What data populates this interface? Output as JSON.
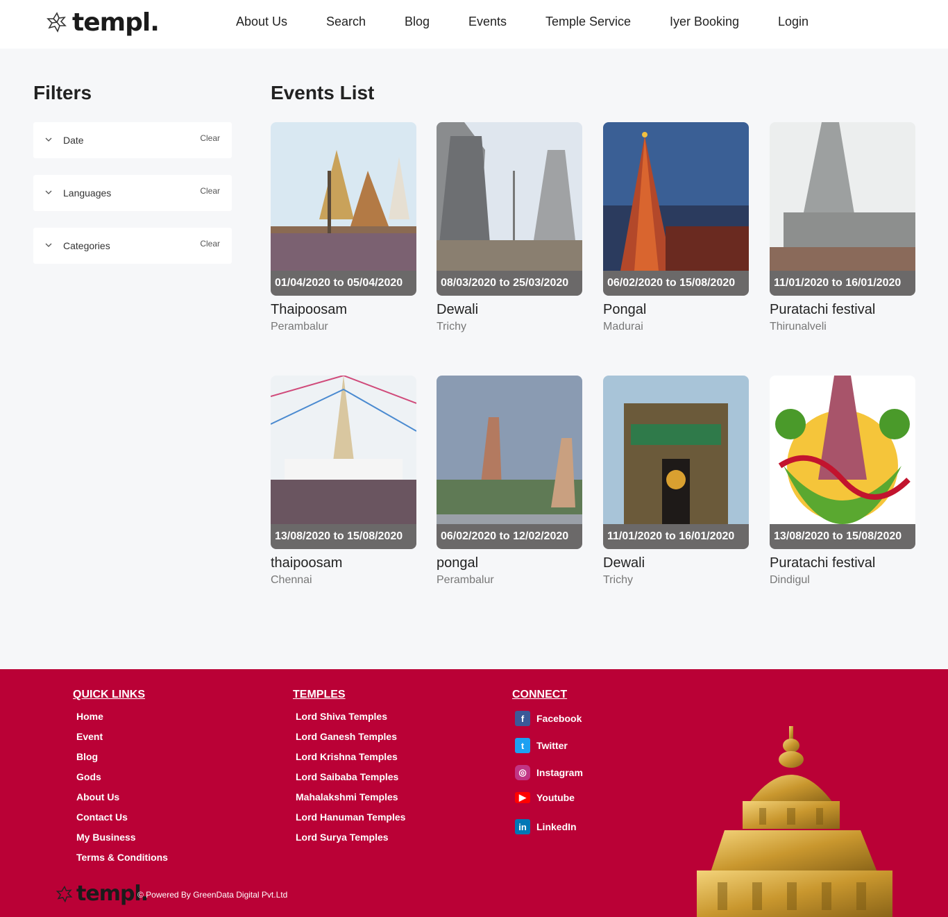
{
  "header": {
    "logo_text": "templ.",
    "nav": [
      "About Us",
      "Search",
      "Blog",
      "Events",
      "Temple Service",
      "Iyer Booking",
      "Login"
    ]
  },
  "filters": {
    "title": "Filters",
    "items": [
      {
        "label": "Date",
        "clear": "Clear"
      },
      {
        "label": "Languages",
        "clear": "Clear"
      },
      {
        "label": "Categories",
        "clear": "Clear"
      }
    ]
  },
  "events": {
    "title": "Events List",
    "items": [
      {
        "date": "01/04/2020 to 05/04/2020",
        "name": "Thaipoosam",
        "location": "Perambalur"
      },
      {
        "date": "08/03/2020 to 25/03/2020",
        "name": "Dewali",
        "location": "Trichy"
      },
      {
        "date": "06/02/2020 to 15/08/2020",
        "name": "Pongal",
        "location": "Madurai"
      },
      {
        "date": "11/01/2020 to 16/01/2020",
        "name": "Puratachi festival",
        "location": "Thirunalveli"
      },
      {
        "date": "13/08/2020 to 15/08/2020",
        "name": "thaipoosam",
        "location": "Chennai"
      },
      {
        "date": "06/02/2020 to 12/02/2020",
        "name": "pongal",
        "location": "Perambalur"
      },
      {
        "date": "11/01/2020 to 16/01/2020",
        "name": "Dewali",
        "location": "Trichy"
      },
      {
        "date": "13/08/2020 to 15/08/2020",
        "name": "Puratachi festival",
        "location": "Dindigul"
      }
    ]
  },
  "footer": {
    "quick_links_title": "QUICK LINKS",
    "quick_links": [
      "Home",
      "Event",
      "Blog",
      "Gods",
      "About Us",
      "Contact Us",
      "My Business",
      "Terms & Conditions"
    ],
    "temples_title": "TEMPLES",
    "temples": [
      "Lord Shiva Temples",
      "Lord Ganesh Temples",
      "Lord Krishna Temples",
      "Lord Saibaba Temples",
      "Mahalakshmi Temples",
      "Lord Hanuman Temples",
      "Lord Surya Temples"
    ],
    "connect_title": "CONNECT",
    "connect": [
      {
        "label": "Facebook",
        "icon": "facebook-icon",
        "color": "#3b5998"
      },
      {
        "label": "Twitter",
        "icon": "twitter-icon",
        "color": "#1da1f2"
      },
      {
        "label": "Instagram",
        "icon": "instagram-icon",
        "color": "#c13584"
      },
      {
        "label": "Youtube",
        "icon": "youtube-icon",
        "color": "#ff0000"
      },
      {
        "label": "LinkedIn",
        "icon": "linkedin-icon",
        "color": "#0077b5"
      }
    ],
    "logo_text": "templ.",
    "powered": "© Powered By GreenData Digital Pvt.Ltd"
  },
  "colors": {
    "footer_bg": "#ba0136",
    "date_bar": "#6b6969",
    "page_bg": "#f6f7f9"
  }
}
